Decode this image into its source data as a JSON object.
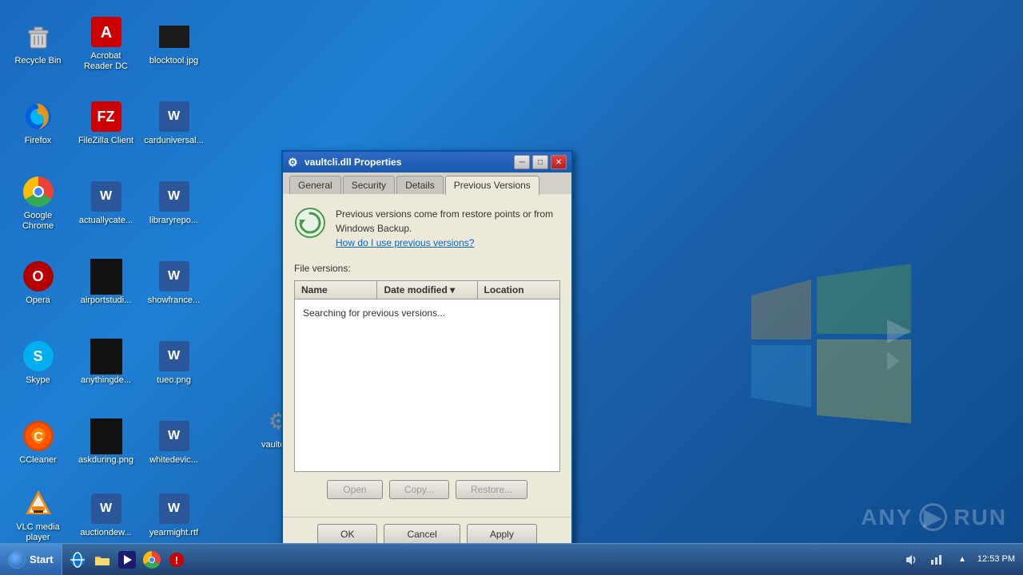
{
  "desktop": {
    "background_color": "#1a5fa8"
  },
  "desktop_icons": [
    {
      "id": "recycle-bin",
      "label": "Recycle Bin",
      "icon_type": "recycle",
      "row": 1,
      "col": 1
    },
    {
      "id": "acrobat",
      "label": "Acrobat Reader DC",
      "icon_type": "acrobat",
      "row": 1,
      "col": 2
    },
    {
      "id": "blocktool",
      "label": "blocktool.jpg",
      "icon_type": "blackbox",
      "row": 1,
      "col": 3
    },
    {
      "id": "firefox",
      "label": "Firefox",
      "icon_type": "firefox",
      "row": 2,
      "col": 1
    },
    {
      "id": "filezilla",
      "label": "FileZilla Client",
      "icon_type": "filezilla",
      "row": 2,
      "col": 2
    },
    {
      "id": "carduniversal",
      "label": "carduniversal...",
      "icon_type": "word",
      "row": 2,
      "col": 3
    },
    {
      "id": "chrome",
      "label": "Google Chrome",
      "icon_type": "chrome",
      "row": 3,
      "col": 1
    },
    {
      "id": "actuallycate",
      "label": "actuallycate...",
      "icon_type": "word",
      "row": 3,
      "col": 2
    },
    {
      "id": "libraryrepo",
      "label": "libraryrepo...",
      "icon_type": "word",
      "row": 3,
      "col": 3
    },
    {
      "id": "opera",
      "label": "Opera",
      "icon_type": "opera",
      "row": 4,
      "col": 1
    },
    {
      "id": "airportstudio",
      "label": "airportstudi...",
      "icon_type": "blackbox",
      "row": 4,
      "col": 2
    },
    {
      "id": "showfrance",
      "label": "showfrance...",
      "icon_type": "word",
      "row": 4,
      "col": 3
    },
    {
      "id": "skype",
      "label": "Skype",
      "icon_type": "skype",
      "row": 5,
      "col": 1
    },
    {
      "id": "anythingde",
      "label": "anythingde...",
      "icon_type": "blackbox",
      "row": 5,
      "col": 2
    },
    {
      "id": "tueo",
      "label": "tueo.png",
      "icon_type": "word",
      "row": 5,
      "col": 3
    },
    {
      "id": "ccleaner",
      "label": "CCleaner",
      "icon_type": "ccleaner",
      "row": 6,
      "col": 1
    },
    {
      "id": "askduring",
      "label": "askduring.png",
      "icon_type": "blackbox",
      "row": 6,
      "col": 2
    },
    {
      "id": "whitedevic",
      "label": "whitedevic...",
      "icon_type": "word",
      "row": 6,
      "col": 3
    },
    {
      "id": "vlc",
      "label": "VLC media player",
      "icon_type": "vlc",
      "row": 7,
      "col": 1
    },
    {
      "id": "auctiondew",
      "label": "auctiondew...",
      "icon_type": "word",
      "row": 7,
      "col": 2
    },
    {
      "id": "yearmight",
      "label": "yearmight.rtf",
      "icon_type": "word",
      "row": 7,
      "col": 3
    },
    {
      "id": "vaultcli",
      "label": "vaultcli...",
      "icon_type": "gear",
      "row": 7,
      "col": 4
    }
  ],
  "dialog": {
    "title": "vaultcli.dll Properties",
    "tabs": [
      {
        "id": "general",
        "label": "General"
      },
      {
        "id": "security",
        "label": "Security"
      },
      {
        "id": "details",
        "label": "Details"
      },
      {
        "id": "previous-versions",
        "label": "Previous Versions",
        "active": true
      }
    ],
    "info_text": "Previous versions come from restore points or from Windows Backup.",
    "info_link": "How do I use previous versions?",
    "file_versions_label": "File versions:",
    "table": {
      "columns": [
        {
          "id": "name",
          "label": "Name"
        },
        {
          "id": "date-modified",
          "label": "Date modified ▾"
        },
        {
          "id": "location",
          "label": "Location"
        }
      ],
      "searching_text": "Searching for previous versions..."
    },
    "buttons": {
      "open": "Open",
      "copy": "Copy...",
      "restore": "Restore...",
      "ok": "OK",
      "cancel": "Cancel",
      "apply": "Apply"
    }
  },
  "taskbar": {
    "start_label": "Start",
    "time": "12:53 PM",
    "icons": [
      "explorer",
      "ie",
      "folder",
      "winamp",
      "chrome",
      "avast"
    ]
  },
  "anyrun": {
    "label": "ANY▶RUN"
  }
}
